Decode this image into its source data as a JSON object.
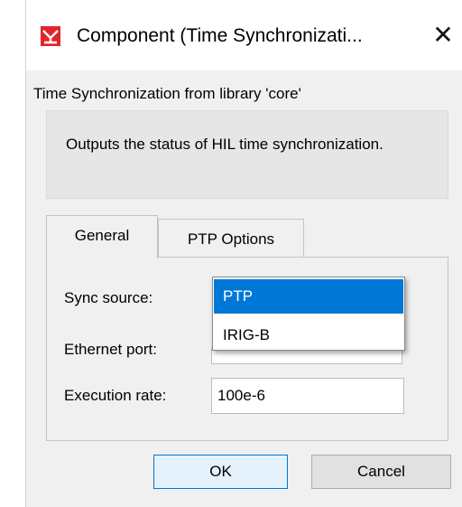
{
  "window": {
    "title": "Component (Time Synchronizati...",
    "close_symbol": "✕",
    "icon_name": "component-app-icon",
    "icon_color": "#e0262b"
  },
  "subtitle": "Time Synchronization from library 'core'",
  "description": "Outputs the status of HIL time synchronization.",
  "tabs": [
    {
      "label": "General",
      "active": true
    },
    {
      "label": "PTP Options",
      "active": false
    }
  ],
  "fields": {
    "sync_source": {
      "label": "Sync source:",
      "selected": "PTP"
    },
    "ethernet_port": {
      "label": "Ethernet port:",
      "value": ""
    },
    "execution_rate": {
      "label": "Execution rate:",
      "value": "100e-6"
    }
  },
  "dropdown": {
    "options": [
      "PTP",
      "IRIG-B"
    ],
    "highlighted": "PTP",
    "highlight_color": "#0078d7"
  },
  "buttons": {
    "ok": "OK",
    "cancel": "Cancel"
  }
}
